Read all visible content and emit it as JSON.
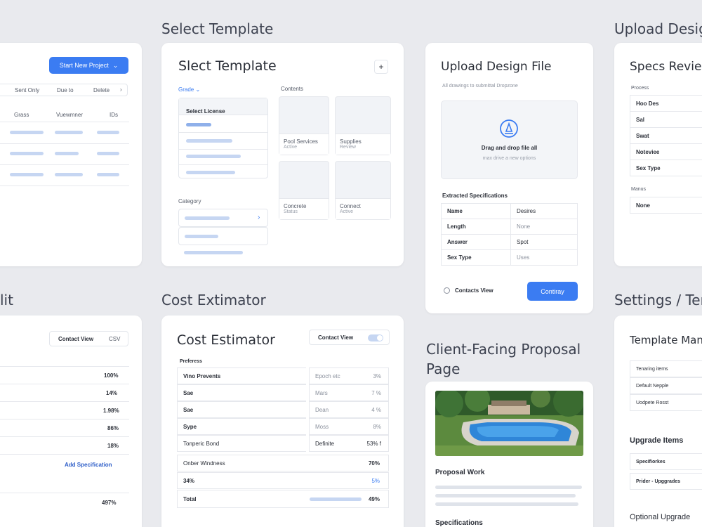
{
  "sections": {
    "select_template": "Select Template",
    "upload_design": "Upload Desig",
    "edit": "lit",
    "cost_estimator": "Cost Extimator",
    "client_proposal": "Client-Facing Proposal Page",
    "settings": "Settings / Ter"
  },
  "project_list": {
    "new_project_button": "Start New Project",
    "filters": [
      "Sent Only",
      "Due to",
      "Delete"
    ],
    "columns": [
      "Grass",
      "Vuewmner",
      "IDs"
    ]
  },
  "template_card": {
    "title": "Slect Template",
    "add_button": "+",
    "grade_dropdown": "Grade",
    "list_header": "Select License",
    "category_label": "Category",
    "contents_label": "Contents",
    "tiles": [
      {
        "name": "Pool Services",
        "sub": "Active"
      },
      {
        "name": "Supplies",
        "sub": "Review"
      },
      {
        "name": "Concrete",
        "sub": "Status"
      },
      {
        "name": "Connect",
        "sub": "Active"
      }
    ]
  },
  "upload_card": {
    "title": "Upload Design File",
    "subtitle": "All drawings to submittal Dropzone",
    "drop_text": "Drag and drop file all",
    "drop_sub": "max drive a new options",
    "specs_header": "Extracted Specifications",
    "specs": [
      {
        "k": "Name",
        "v": "Desires"
      },
      {
        "k": "Length",
        "v": "None"
      },
      {
        "k": "Answer",
        "v": "Spot"
      },
      {
        "k": "Sex Type",
        "v": "Uses"
      }
    ],
    "contacts_view": "Contacts View",
    "continue_button": "Contiray"
  },
  "specs_review": {
    "title": "Specs Review",
    "section_label": "Process",
    "rows": [
      "Hoo Des",
      "Sal",
      "Swat",
      "Noteviee",
      "Sex Type"
    ],
    "sub_label": "Manus",
    "sub_rows": [
      "None"
    ]
  },
  "edit_card": {
    "contact_view": "Contact View",
    "csv_label": "CSV",
    "values": [
      "100%",
      "14%",
      "1.98%",
      "86%",
      "18%"
    ],
    "add_specification": "Add Specification",
    "total": "497%"
  },
  "cost_card": {
    "title": "Cost Estimator",
    "toggle_label": "Contact View",
    "section_label": "Preferess",
    "rows": [
      {
        "label": "Vino Prevents",
        "field": "Epoch etc",
        "val": "3%"
      },
      {
        "label": "Sae",
        "field": "Mars",
        "val": "7 %"
      },
      {
        "label": "Sae",
        "field": "Dean",
        "val": "4 %"
      },
      {
        "label": "Sype",
        "field": "Moss",
        "val": "8%"
      },
      {
        "label": "Tonperic Bond",
        "field": "Definite",
        "val": "53% f"
      }
    ],
    "other_label": "Onber Windness",
    "other_val": "70%",
    "row34_label": "34%",
    "row34_val": "5%",
    "total_label": "Total",
    "total_val": "49%"
  },
  "proposal_card": {
    "section_title": "Proposal Work",
    "specifications": "Specifications"
  },
  "settings_card": {
    "title": "Template Man",
    "rows": [
      "Tenaring items",
      "Default Nepple",
      "Uodpete Rosst"
    ],
    "upgrade_title": "Upgrade Items",
    "upgrade_rows": [
      "Specifiorkes",
      "Prider - Upggrades"
    ],
    "optional_title": "Optional Upgrade"
  },
  "colors": {
    "accent": "#3b7cf2",
    "background": "#e9eaee",
    "card": "#ffffff"
  }
}
